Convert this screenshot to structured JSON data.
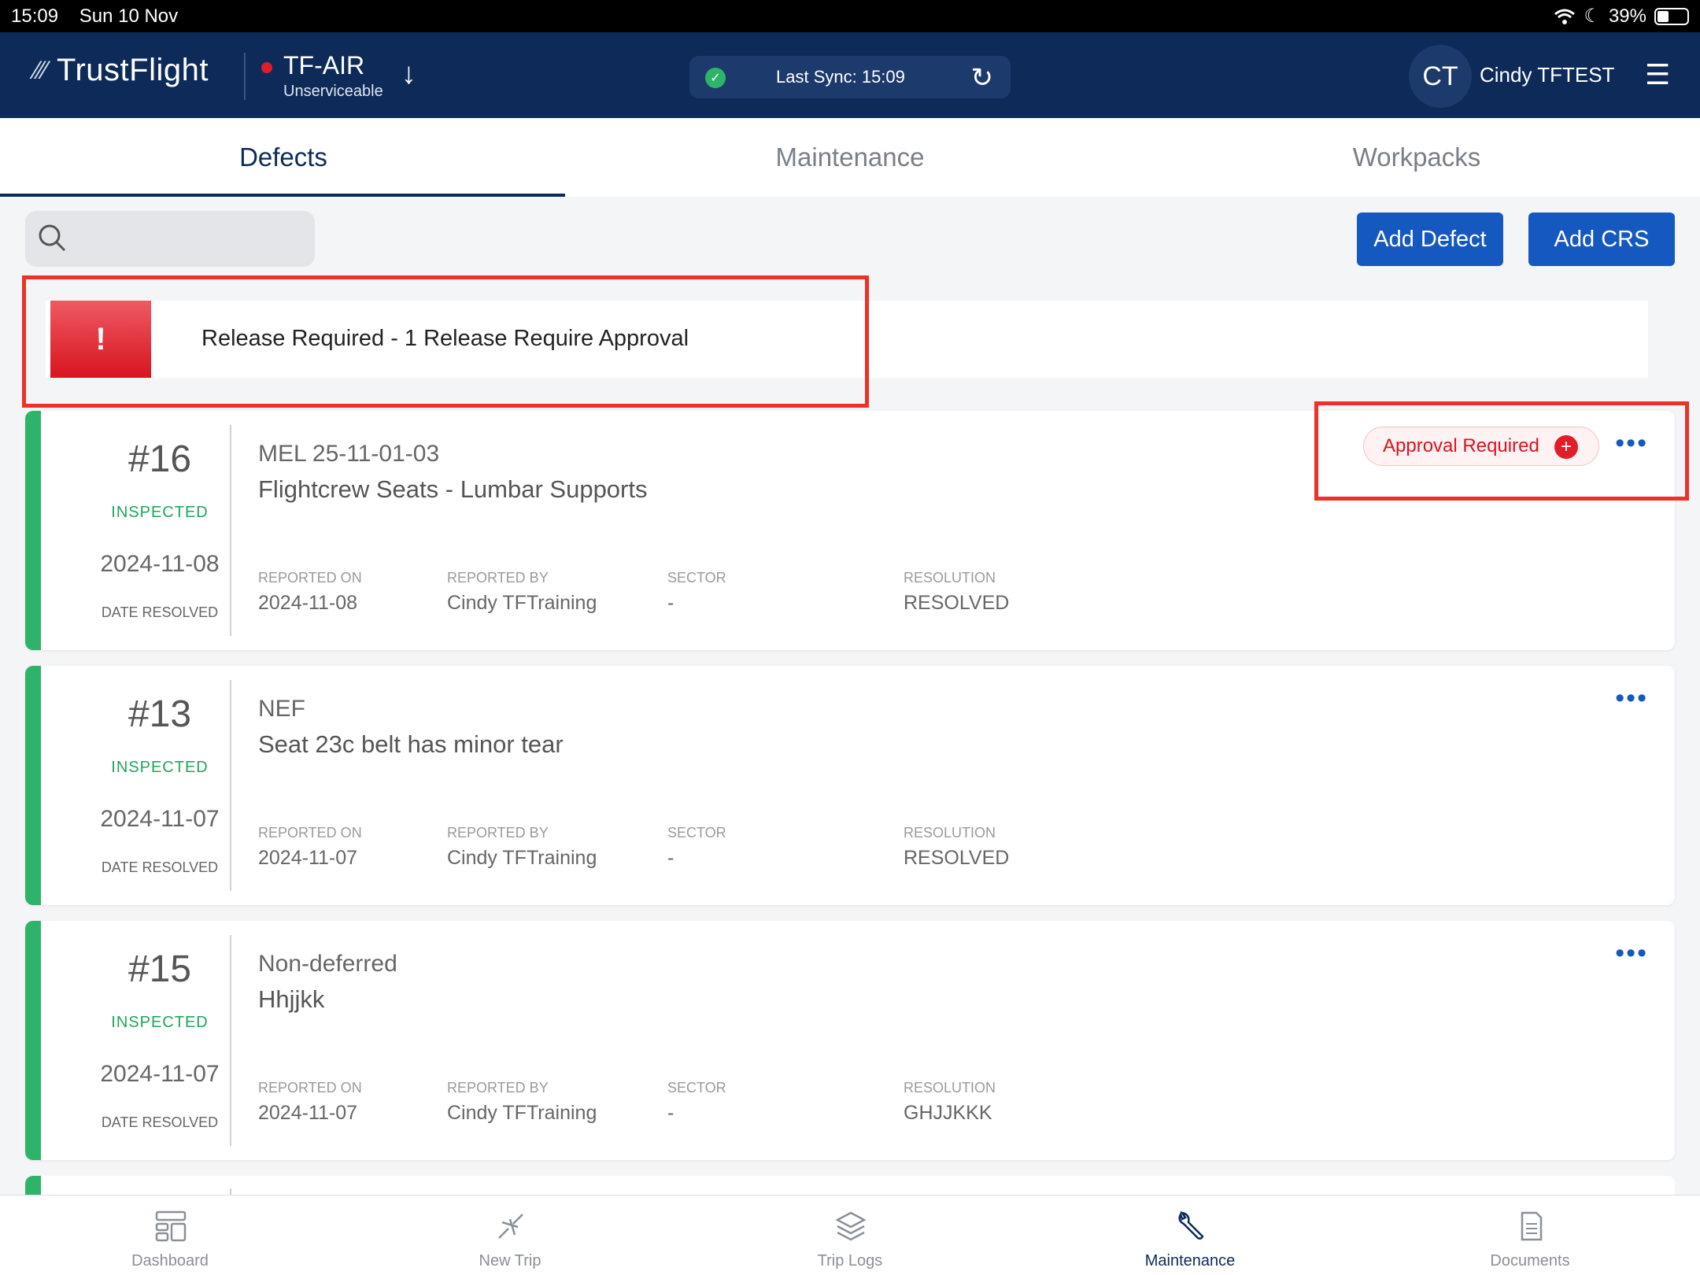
{
  "status_bar": {
    "time": "15:09",
    "date": "Sun 10 Nov",
    "battery": "39%"
  },
  "header": {
    "logo": "TrustFlight",
    "aircraft": {
      "registration": "TF-AIR",
      "status": "Unserviceable"
    },
    "sync": {
      "label": "Last Sync: 15:09"
    },
    "user": {
      "initials": "CT",
      "name": "Cindy TFTEST"
    }
  },
  "tabs": [
    "Defects",
    "Maintenance",
    "Workpacks"
  ],
  "actions": {
    "add_defect": "Add Defect",
    "add_crs": "Add CRS"
  },
  "alert": {
    "icon_glyph": "!",
    "text": "Release Required - 1 Release Require Approval"
  },
  "labels": {
    "date_resolved": "DATE RESOLVED",
    "reported_on": "REPORTED ON",
    "reported_by": "REPORTED BY",
    "sector": "SECTOR",
    "resolution": "RESOLUTION"
  },
  "defects": [
    {
      "number": "#16",
      "state": "INSPECTED",
      "date_resolved": "2024-11-08",
      "type": "MEL   25-11-01-03",
      "title": "Flightcrew Seats - Lumbar Supports",
      "reported_on": "2024-11-08",
      "reported_by": "Cindy  TFTraining",
      "sector": "-",
      "resolution": "RESOLVED",
      "badge": "Approval Required"
    },
    {
      "number": "#13",
      "state": "INSPECTED",
      "date_resolved": "2024-11-07",
      "type": "NEF",
      "title": "Seat 23c belt has minor tear",
      "reported_on": "2024-11-07",
      "reported_by": "Cindy  TFTraining",
      "sector": "-",
      "resolution": "RESOLVED"
    },
    {
      "number": "#15",
      "state": "INSPECTED",
      "date_resolved": "2024-11-07",
      "type": "Non-deferred",
      "title": "Hhjjkk",
      "reported_on": "2024-11-07",
      "reported_by": "Cindy  TFTraining",
      "sector": "-",
      "resolution": "GHJJKKK"
    }
  ],
  "bottom_nav": [
    "Dashboard",
    "New Trip",
    "Trip Logs",
    "Maintenance",
    "Documents"
  ],
  "colors": {
    "navy": "#0e2a58",
    "accent_blue": "#1558c0",
    "inspected_green": "#2fb36a",
    "alert_red": "#e11d2a"
  }
}
